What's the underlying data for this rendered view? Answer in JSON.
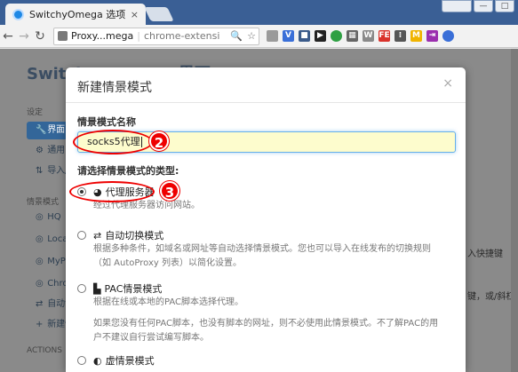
{
  "browser": {
    "tab_title": "SwitchyOmega 选项",
    "tab_close": "×",
    "window_controls": [
      "",
      "—",
      "□"
    ],
    "omnibox": {
      "ext_name": "Proxy...mega",
      "url": "chrome-extensi",
      "icons": [
        "zoom-icon",
        "star-icon"
      ]
    },
    "extension_icons": [
      {
        "name": "puzzle-grey-icon",
        "color": "#9a9a9a",
        "glyph": ""
      },
      {
        "name": "vpn-v-icon",
        "color": "#3a6fd8",
        "glyph": "V"
      },
      {
        "name": "readlater-icon",
        "color": "#3b5b8a",
        "glyph": "■"
      },
      {
        "name": "black-ext-icon",
        "color": "#222222",
        "glyph": "▶"
      },
      {
        "name": "green-circle-icon",
        "color": "#2ea043",
        "glyph": ""
      },
      {
        "name": "grid-ext-icon",
        "color": "#666666",
        "glyph": "▦"
      },
      {
        "name": "w-ext-icon",
        "color": "#8a8a8a",
        "glyph": "W"
      },
      {
        "name": "fe-ext-icon",
        "color": "#d9322b",
        "glyph": "FE"
      },
      {
        "name": "bookmark-ext-icon",
        "color": "#555555",
        "glyph": "⁞"
      },
      {
        "name": "m-ext-icon",
        "color": "#f0b400",
        "glyph": "M"
      },
      {
        "name": "arrow-ext-icon",
        "color": "#9b2fae",
        "glyph": "⇥"
      },
      {
        "name": "omega-ext-icon",
        "color": "#3a6fd8",
        "glyph": ""
      }
    ]
  },
  "page": {
    "title": "SwitchyOmega - 界面",
    "settings_heading": "设定",
    "settings_items": [
      {
        "icon": "🔧",
        "label": "界面"
      },
      {
        "icon": "⚙",
        "label": "通用"
      },
      {
        "icon": "⇅",
        "label": "导入/导出"
      }
    ],
    "profiles_heading": "情景模式",
    "profile_items": [
      {
        "icon": "◎",
        "label": "HQ"
      },
      {
        "icon": "◎",
        "label": "Local"
      },
      {
        "icon": "◎",
        "label": "MyProxy"
      },
      {
        "icon": "◎",
        "label": "Chrome"
      },
      {
        "icon": "⇄",
        "label": "自动切换"
      },
      {
        "icon": "+",
        "label": "新建情景模式"
      }
    ],
    "actions_heading": "ACTIONS",
    "right_text": [
      "入快捷键",
      "键，或/斜杠"
    ]
  },
  "modal": {
    "title": "新建情景模式",
    "close": "×",
    "name_label": "情景模式名称",
    "name_value": "socks5代理",
    "type_label": "请选择情景模式的类型:",
    "options": [
      {
        "icon": "◕",
        "label": "代理服务器",
        "checked": true,
        "help": [
          "经过代理服务器访问网站。"
        ]
      },
      {
        "icon": "⇄",
        "label": "自动切换模式",
        "checked": false,
        "help": [
          "根据多种条件，如域名或网址等自动选择情景模式。您也可以导入在线发布的切换规则",
          "（如 AutoProxy 列表）以简化设置。"
        ]
      },
      {
        "icon": "▙",
        "label": "PAC情景模式",
        "checked": false,
        "help": [
          "根据在线或本地的PAC脚本选择代理。",
          "",
          "如果您没有任何PAC脚本，也没有脚本的网址，则不必使用此情景模式。不了解PAC的用",
          "户不建议自行尝试编写脚本。"
        ]
      },
      {
        "icon": "◐",
        "label": "虚情景模式",
        "checked": false,
        "help": []
      }
    ],
    "annotations": [
      "2",
      "3"
    ]
  }
}
